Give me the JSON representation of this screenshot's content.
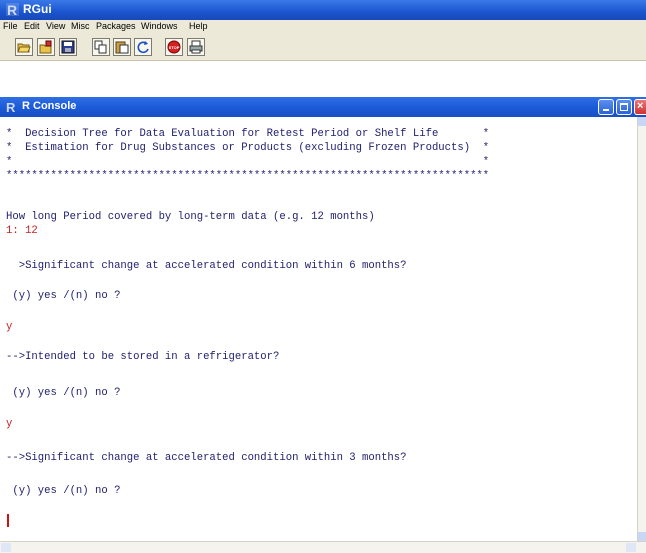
{
  "app": {
    "title": "RGui"
  },
  "menubar": {
    "items": [
      "File",
      "Edit",
      "View",
      "Misc",
      "Packages",
      "Windows",
      "Help"
    ]
  },
  "toolbar": {
    "buttons": [
      "open-script-icon",
      "load-workspace-icon",
      "save-workspace-icon",
      "copy-icon",
      "paste-icon",
      "refresh-icon",
      "stop-icon",
      "print-icon"
    ],
    "stop_label": "STOP"
  },
  "console": {
    "title": "R Console",
    "lines": [
      {
        "text": "*  Decision Tree for Data Evaluation for Retest Period or Shelf Life       *",
        "kind": "output"
      },
      {
        "text": "*  Estimation for Drug Substances or Products (excluding Frozen Products)  *",
        "kind": "output"
      },
      {
        "text": "*                                                                          *",
        "kind": "output"
      },
      {
        "text": "****************************************************************************",
        "kind": "output"
      },
      {
        "text": "How long Period covered by long-term data (e.g. 12 months)",
        "kind": "output"
      },
      {
        "text": "1: 12",
        "kind": "input"
      },
      {
        "text": "  >Significant change at accelerated condition within 6 months?",
        "kind": "output"
      },
      {
        "text": " (y) yes /(n) no ?",
        "kind": "output"
      },
      {
        "text": "y",
        "kind": "input"
      },
      {
        "text": "-->Intended to be stored in a refrigerator?",
        "kind": "output"
      },
      {
        "text": " (y) yes /(n) no ?",
        "kind": "output"
      },
      {
        "text": "y",
        "kind": "input"
      },
      {
        "text": "-->Significant change at accelerated condition within 3 months?",
        "kind": "output"
      },
      {
        "text": " (y) yes /(n) no ?",
        "kind": "output"
      }
    ]
  },
  "colors": {
    "output_text": "#1e1e6e",
    "input_text": "#c81e1e",
    "titlebar": "#1b5ad6"
  }
}
